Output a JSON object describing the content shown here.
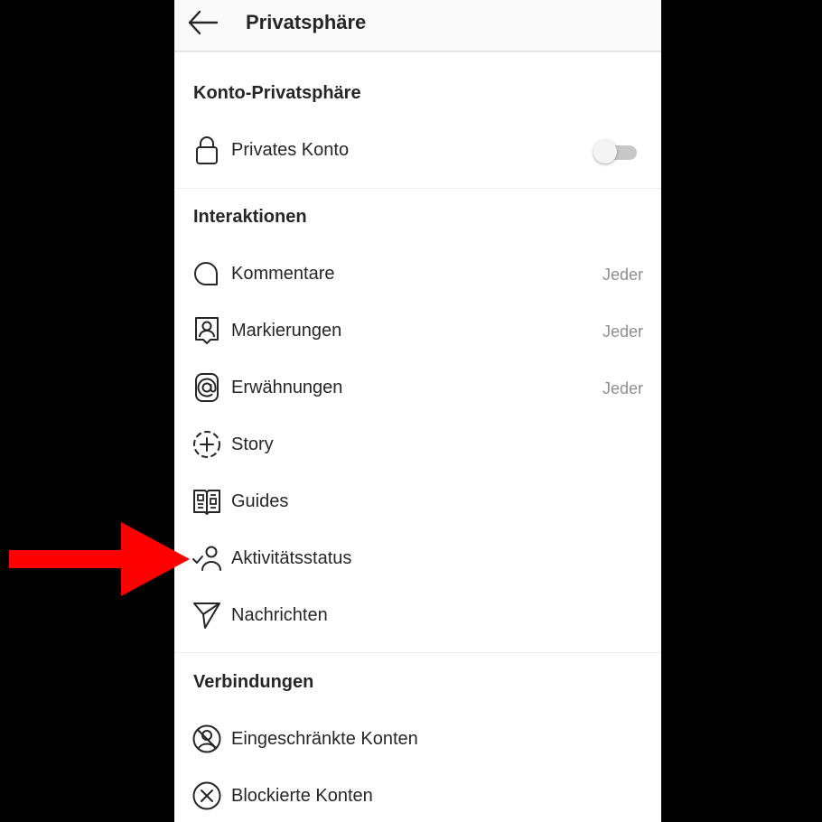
{
  "header": {
    "title": "Privatsphäre",
    "back_icon": "arrow-left-icon"
  },
  "sections": {
    "account": {
      "title": "Konto-Privatsphäre",
      "private_account": {
        "label": "Privates Konto",
        "icon": "lock-icon",
        "toggle_on": false
      }
    },
    "interactions": {
      "title": "Interaktionen",
      "items": [
        {
          "label": "Kommentare",
          "value": "Jeder",
          "icon": "comment-icon"
        },
        {
          "label": "Markierungen",
          "value": "Jeder",
          "icon": "tag-person-icon"
        },
        {
          "label": "Erwähnungen",
          "value": "Jeder",
          "icon": "at-sign-icon"
        },
        {
          "label": "Story",
          "icon": "story-add-icon"
        },
        {
          "label": "Guides",
          "icon": "guides-icon"
        },
        {
          "label": "Aktivitätsstatus",
          "icon": "activity-status-icon"
        },
        {
          "label": "Nachrichten",
          "icon": "paper-plane-icon"
        }
      ]
    },
    "connections": {
      "title": "Verbindungen",
      "items": [
        {
          "label": "Eingeschränkte Konten",
          "icon": "restricted-icon"
        },
        {
          "label": "Blockierte Konten",
          "icon": "blocked-icon"
        }
      ]
    }
  },
  "annotation": {
    "arrow_color": "#ff0000",
    "points_to": "Aktivitätsstatus"
  },
  "colors": {
    "text": "#262626",
    "secondary_text": "#8e8e8e",
    "background": "#ffffff",
    "toggle_track": "#c7c7c7"
  }
}
